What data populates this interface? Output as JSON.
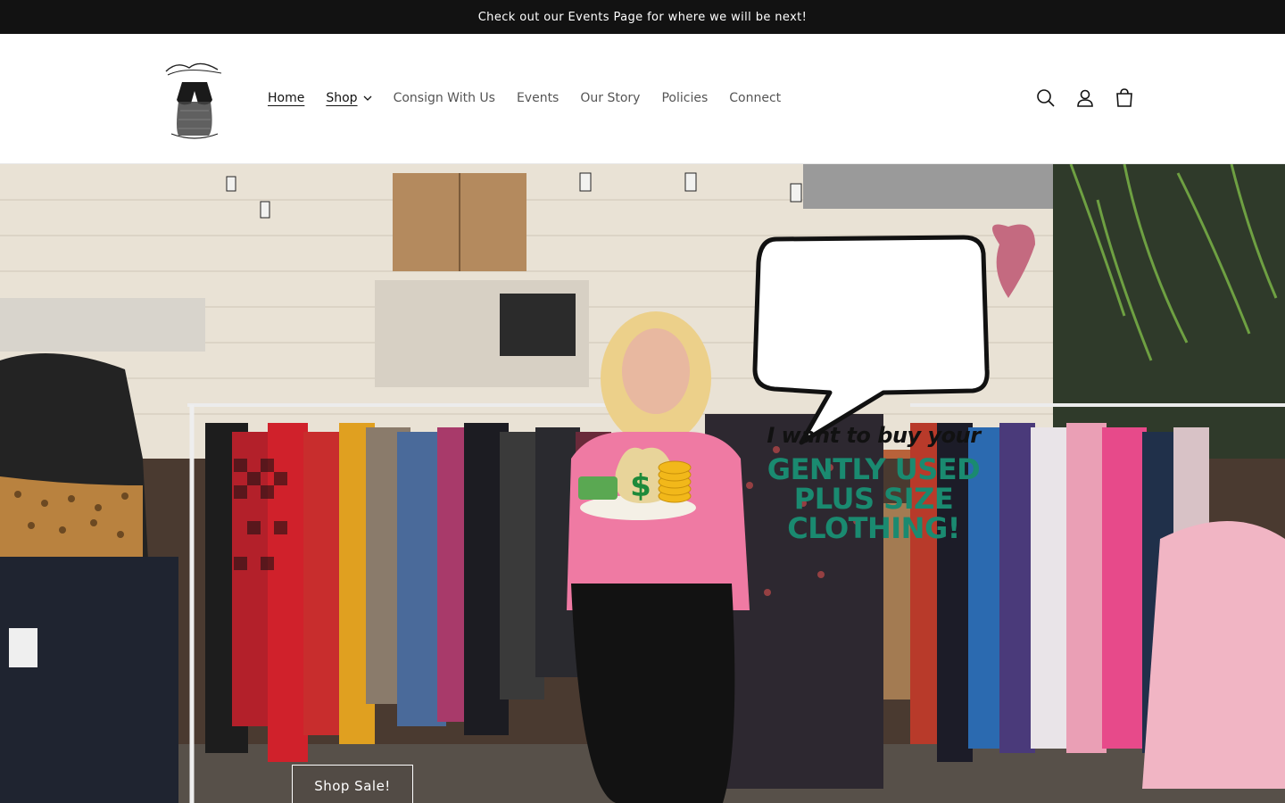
{
  "announcement": {
    "text": "Check out our Events Page for where we will be next!"
  },
  "header": {
    "logo_name": "Curvy Chic Shop logo",
    "nav": [
      {
        "label": "Home"
      },
      {
        "label": "Shop"
      },
      {
        "label": "Consign With Us"
      },
      {
        "label": "Events"
      },
      {
        "label": "Our Story"
      },
      {
        "label": "Policies"
      },
      {
        "label": "Connect"
      }
    ],
    "icons": [
      "search-icon",
      "account-icon",
      "cart-icon"
    ]
  },
  "hero": {
    "bubble_line1": "I want to buy your",
    "bubble_line2": "GENTLY USED",
    "bubble_line3": "PLUS SIZE",
    "bubble_line4": "CLOTHING!",
    "cta_label": "Shop Sale!"
  },
  "colors": {
    "announcement_bg": "#121212",
    "accent_green": "#1a8a70",
    "hoodie_pink": "#ef7aa3"
  }
}
